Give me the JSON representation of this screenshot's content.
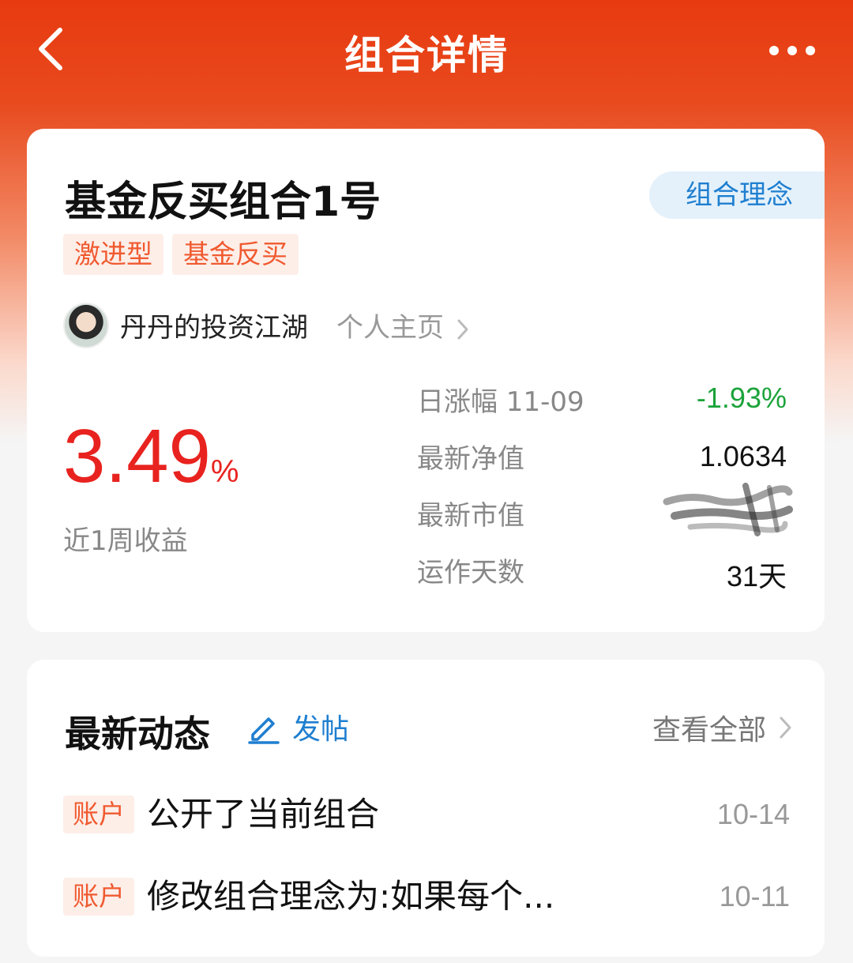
{
  "nav": {
    "title": "组合详情"
  },
  "portfolio": {
    "name": "基金反买组合1号",
    "concept_button": "组合理念",
    "tags": [
      "激进型",
      "基金反买"
    ],
    "author": "丹丹的投资江湖",
    "homepage_link": "个人主页",
    "return_value": "3.49",
    "return_unit": "%",
    "return_label": "近1周收益",
    "stats": [
      {
        "label": "日涨幅 11-09",
        "value": "-1.93%"
      },
      {
        "label": "最新净值",
        "value": "1.0634"
      },
      {
        "label": "最新市值",
        "value": ""
      },
      {
        "label": "运作天数",
        "value": "31天"
      }
    ]
  },
  "feed": {
    "title": "最新动态",
    "post_label": "发帖",
    "view_all": "查看全部",
    "items": [
      {
        "tag": "账户",
        "text": "公开了当前组合",
        "date": "10-14"
      },
      {
        "tag": "账户",
        "text": "修改组合理念为:如果每个...",
        "date": "10-11"
      }
    ]
  },
  "colors": {
    "header": "#e83a10",
    "accent_red": "#e8231f",
    "accent_green": "#1ba33a",
    "link_blue": "#1f7fd0",
    "tag_text": "#f05a30",
    "tag_bg": "#fdeee8"
  },
  "icons": [
    "back-arrow-icon",
    "more-icon",
    "chevron-right-icon",
    "edit-pencil-icon"
  ]
}
